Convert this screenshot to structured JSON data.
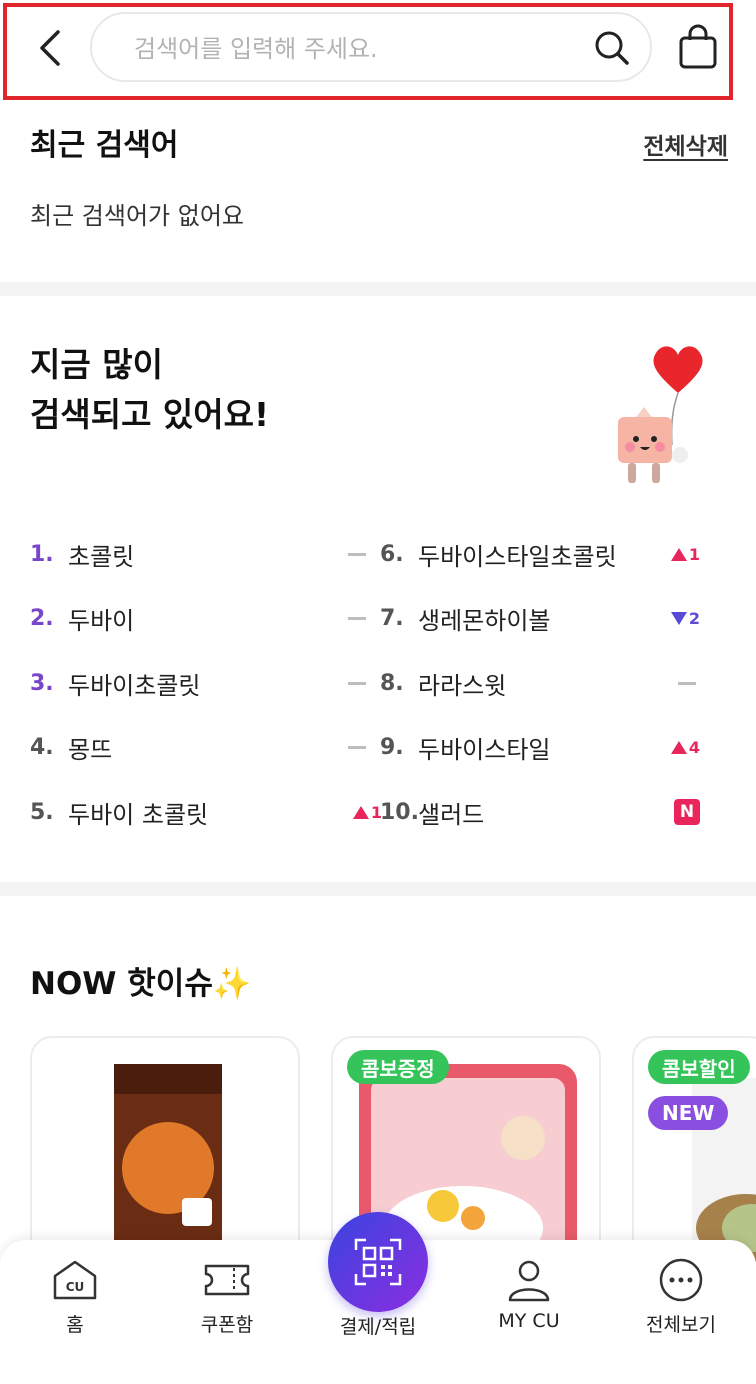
{
  "search": {
    "placeholder": "검색어를 입력해 주세요."
  },
  "recent": {
    "title": "최근 검색어",
    "delete_all": "전체삭제",
    "empty": "최근 검색어가 없어요"
  },
  "popular": {
    "title_line1": "지금 많이",
    "title_line2": "검색되고 있어요!",
    "ranks": [
      {
        "num": "1.",
        "label": "초콜릿",
        "change": "same"
      },
      {
        "num": "2.",
        "label": "두바이",
        "change": "same"
      },
      {
        "num": "3.",
        "label": "두바이초콜릿",
        "change": "same"
      },
      {
        "num": "4.",
        "label": "몽뜨",
        "change": "same"
      },
      {
        "num": "5.",
        "label": "두바이 초콜릿",
        "change": "up",
        "delta": "1"
      },
      {
        "num": "6.",
        "label": "두바이스타일초콜릿",
        "change": "up",
        "delta": "1"
      },
      {
        "num": "7.",
        "label": "생레몬하이볼",
        "change": "down",
        "delta": "2"
      },
      {
        "num": "8.",
        "label": "라라스윗",
        "change": "same"
      },
      {
        "num": "9.",
        "label": "두바이스타일",
        "change": "up",
        "delta": "4"
      },
      {
        "num": "10.",
        "label": "샐러드",
        "change": "new",
        "badge": "N"
      }
    ]
  },
  "now_hot": {
    "title": "NOW 핫이슈✨",
    "cards": [
      {
        "tags": []
      },
      {
        "tags": [
          "콤보증정"
        ]
      },
      {
        "tags": [
          "콤보할인",
          "NEW"
        ]
      }
    ]
  },
  "nav": {
    "home": "홈",
    "coupon": "쿠폰함",
    "pay": "결제/적립",
    "mycu": "MY CU",
    "more": "전체보기"
  },
  "colors": {
    "accent_purple": "#7a46c9",
    "up_red": "#e8265b",
    "down_blue": "#5a4bd6",
    "tag_green": "#35c45a"
  }
}
